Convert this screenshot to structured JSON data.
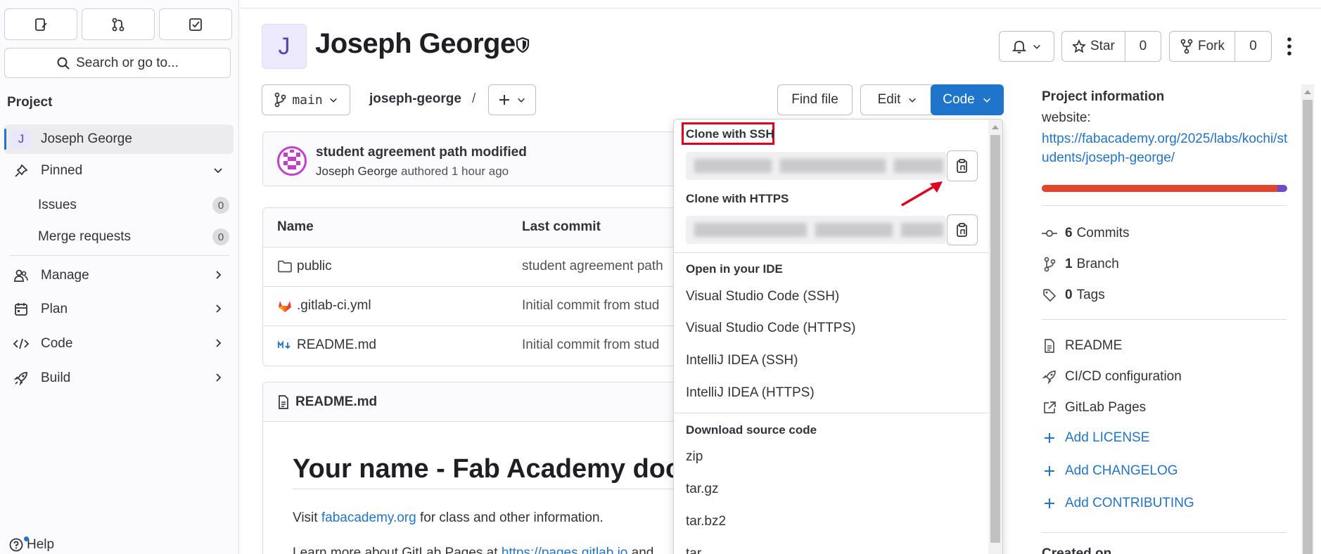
{
  "sidebar": {
    "search_label": "Search or go to...",
    "section_title": "Project",
    "project_item": {
      "avatar_letter": "J",
      "label": "Joseph George"
    },
    "pinned_label": "Pinned",
    "pinned_items": [
      {
        "label": "Issues",
        "count": "0"
      },
      {
        "label": "Merge requests",
        "count": "0"
      }
    ],
    "nav_items": [
      {
        "label": "Manage",
        "icon": "users-icon"
      },
      {
        "label": "Plan",
        "icon": "calendar-icon"
      },
      {
        "label": "Code",
        "icon": "code-icon"
      },
      {
        "label": "Build",
        "icon": "rocket-icon"
      }
    ],
    "help_label": "Help"
  },
  "header": {
    "avatar_letter": "J",
    "title": "Joseph George",
    "star_label": "Star",
    "star_count": "0",
    "fork_label": "Fork",
    "fork_count": "0"
  },
  "toolbar": {
    "branch": "main",
    "path": "joseph-george",
    "path_sep": "/",
    "find_file": "Find file",
    "edit": "Edit",
    "code": "Code"
  },
  "commit": {
    "title": "student agreement path modified",
    "author": "Joseph George",
    "meta": "authored 1 hour ago"
  },
  "files": {
    "headers": [
      "Name",
      "Last commit"
    ],
    "rows": [
      {
        "name": "public",
        "icon": "folder-icon",
        "commit": "student agreement path"
      },
      {
        "name": ".gitlab-ci.yml",
        "icon": "gitlab-icon",
        "commit": "Initial commit from stud"
      },
      {
        "name": "README.md",
        "icon": "markdown-icon",
        "commit": "Initial commit from stud"
      }
    ]
  },
  "readme": {
    "file_name": "README.md",
    "heading": "Your name - Fab Academy doc",
    "p1_prefix": "Visit ",
    "p1_link": "fabacademy.org",
    "p1_suffix": " for class and other information.",
    "p2_prefix": "Learn more about GitLab Pages at ",
    "p2_link": "https://pages.gitlab.io",
    "p2_suffix": " and"
  },
  "code_dropdown": {
    "ssh_label": "Clone with SSH",
    "https_label": "Clone with HTTPS",
    "ide_label": "Open in your IDE",
    "ide_items": [
      "Visual Studio Code (SSH)",
      "Visual Studio Code (HTTPS)",
      "IntelliJ IDEA (SSH)",
      "IntelliJ IDEA (HTTPS)"
    ],
    "download_label": "Download source code",
    "download_items": [
      "zip",
      "tar.gz",
      "tar.bz2",
      "tar"
    ]
  },
  "project_info": {
    "title": "Project information",
    "website_label": "website:",
    "website_url": "https://fabacademy.org/2025/labs/kochi/students/joseph-george/",
    "language_bar": [
      {
        "color": "#e24329",
        "fraction": 0.96
      },
      {
        "color": "#6e49cb",
        "fraction": 0.04
      }
    ],
    "commits_count": "6",
    "commits_label": "Commits",
    "branch_count": "1",
    "branch_label": "Branch",
    "tags_count": "0",
    "tags_label": "Tags",
    "links": [
      "README",
      "CI/CD configuration",
      "GitLab Pages"
    ],
    "add_links": [
      "Add LICENSE",
      "Add CHANGELOG",
      "Add CONTRIBUTING"
    ],
    "created_on": "Created on"
  },
  "colors": {
    "accent": "#1f75cb",
    "highlight": "#e2001a"
  }
}
